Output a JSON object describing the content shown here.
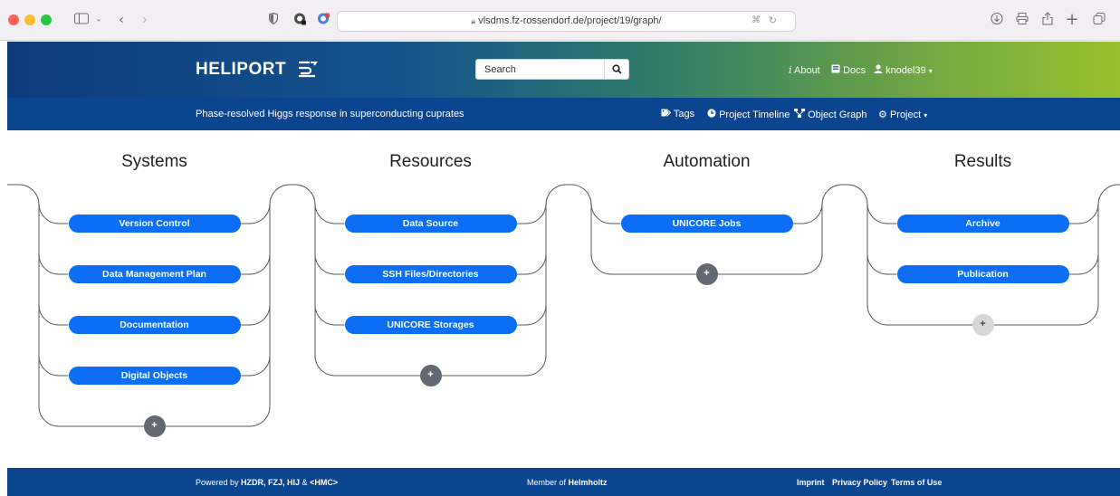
{
  "browser": {
    "url": "vlsdms.fz-rossendorf.de/project/19/graph/"
  },
  "navbar": {
    "brand": "HELIPORT",
    "search_placeholder": "Search",
    "about": "About",
    "docs": "Docs",
    "user": "knodel39"
  },
  "subnav": {
    "project_title": "Phase-resolved Higgs response in superconducting cuprates",
    "tags": "Tags",
    "timeline": "Project Timeline",
    "object_graph": "Object Graph",
    "project": "Project"
  },
  "graph": {
    "columns": [
      {
        "title": "Systems",
        "nodes": [
          "Version Control",
          "Data Management Plan",
          "Documentation",
          "Digital Objects"
        ],
        "add_label": "+"
      },
      {
        "title": "Resources",
        "nodes": [
          "Data Source",
          "SSH Files/Directories",
          "UNICORE Storages"
        ],
        "add_label": "+"
      },
      {
        "title": "Automation",
        "nodes": [
          "UNICORE Jobs"
        ],
        "add_label": "+"
      },
      {
        "title": "Results",
        "nodes": [
          "Archive",
          "Publication"
        ],
        "add_label": "+"
      }
    ]
  },
  "footer": {
    "powered_prefix": "Powered by ",
    "powered_orgs": "HZDR, FZJ, HIJ",
    "powered_amp": " & ",
    "powered_hmc": "<HMC>",
    "member_prefix": "Member of ",
    "member_org": "Helmholtz",
    "imprint": "Imprint",
    "privacy": "Privacy Policy",
    "terms": "Terms of Use"
  },
  "colors": {
    "node": "#0b6ef5",
    "nav_dark": "#0b4590",
    "add_button": "#636973",
    "add_button_disabled": "#d7d7d7"
  }
}
